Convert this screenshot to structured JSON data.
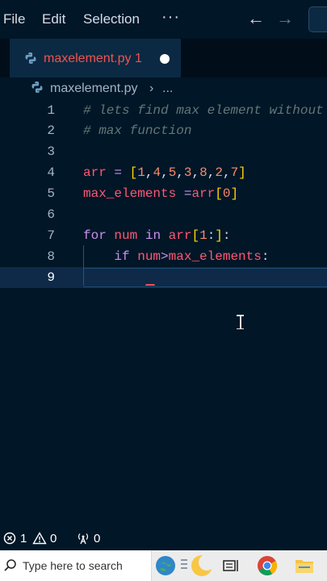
{
  "menu": {
    "file": "File",
    "edit": "Edit",
    "selection": "Selection",
    "more": "···"
  },
  "tab": {
    "filename": "maxelement.py",
    "problems": "1",
    "icon": "python-icon"
  },
  "breadcrumb": {
    "file": "maxelement.py",
    "separator": "›",
    "more": "..."
  },
  "editor": {
    "line_numbers": [
      "1",
      "2",
      "3",
      "4",
      "5",
      "6",
      "7",
      "8",
      "9"
    ],
    "current_line": 9
  },
  "status": {
    "errors": "1",
    "warnings": "0",
    "ports": "0"
  },
  "taskbar": {
    "search_placeholder": "Type here to search"
  },
  "colors": {
    "background": "#011627",
    "accent": "#ef5350",
    "keyword": "#c792ea",
    "variable": "#ff5874",
    "number": "#f78c6c",
    "comment": "#637777"
  }
}
